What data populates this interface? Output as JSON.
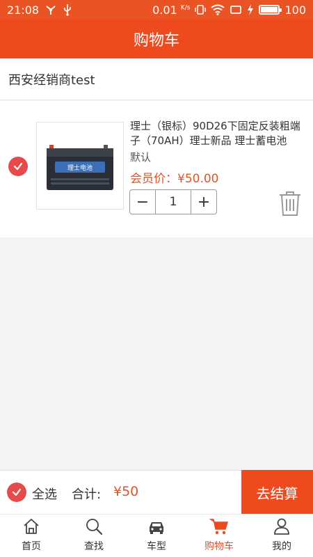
{
  "status": {
    "time": "21:08",
    "speed": "0.01",
    "speed_unit": "K/s",
    "battery_text": "100",
    "battery_level": 1.0
  },
  "header": {
    "title": "购物车"
  },
  "store": {
    "name": "西安经销商test"
  },
  "cart_item": {
    "title": "理士（银标）90D26下固定反装粗端子（70AH）理士新品 理士蓄电池",
    "spec": "默认",
    "price": "会员价：¥50.00",
    "quantity": "1",
    "minus": "−",
    "plus": "+",
    "image_label": "理士电池",
    "checked": true
  },
  "footer": {
    "select_all": "全选",
    "total_label": "合计:",
    "total_value": "¥50",
    "checkout": "去结算"
  },
  "tabs": [
    {
      "label": "首页",
      "icon": "home-icon",
      "active": false
    },
    {
      "label": "查找",
      "icon": "search-icon",
      "active": false
    },
    {
      "label": "车型",
      "icon": "car-icon",
      "active": false
    },
    {
      "label": "购物车",
      "icon": "cart-icon",
      "active": true
    },
    {
      "label": "我的",
      "icon": "user-icon",
      "active": false
    }
  ],
  "colors": {
    "primary": "#ee4a1e",
    "check": "#e64b4b",
    "price": "#e0542a"
  }
}
